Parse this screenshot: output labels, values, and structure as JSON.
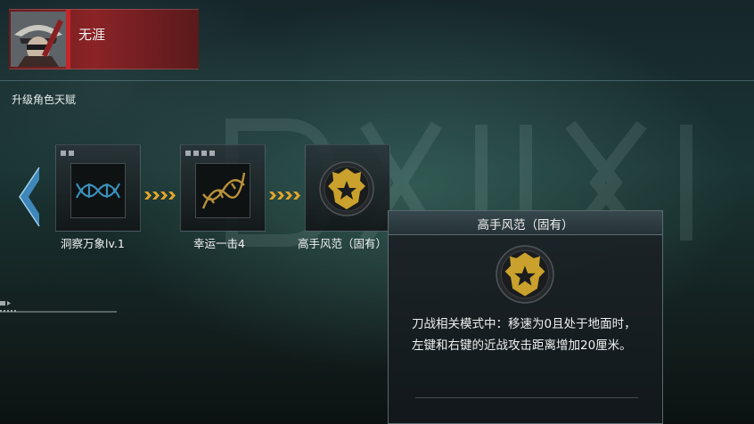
{
  "character": {
    "name": "无涯",
    "accent_color": "#c4262b",
    "portrait_icon": "character-portrait"
  },
  "section": {
    "title": "升级角色天赋"
  },
  "talents": [
    {
      "label": "洞察万象lv.1",
      "level_pips": 2,
      "icon": "dna-helix-blue-icon"
    },
    {
      "label": "幸运一击4",
      "level_pips": 4,
      "icon": "dna-helix-gold-icon"
    },
    {
      "label": "高手风范（固有）",
      "icon": "gold-emblem-icon"
    }
  ],
  "tooltip": {
    "title": "高手风范（固有）",
    "icon": "gold-emblem-icon",
    "description": "刀战相关模式中：移速为0且处于地面时，左键和右键的近战攻击距离增加20厘米。"
  },
  "colors": {
    "arrow_gold": "#e0a52c",
    "emblem_gold": "#c9a12c",
    "nav_blue": "#3e87b8"
  }
}
